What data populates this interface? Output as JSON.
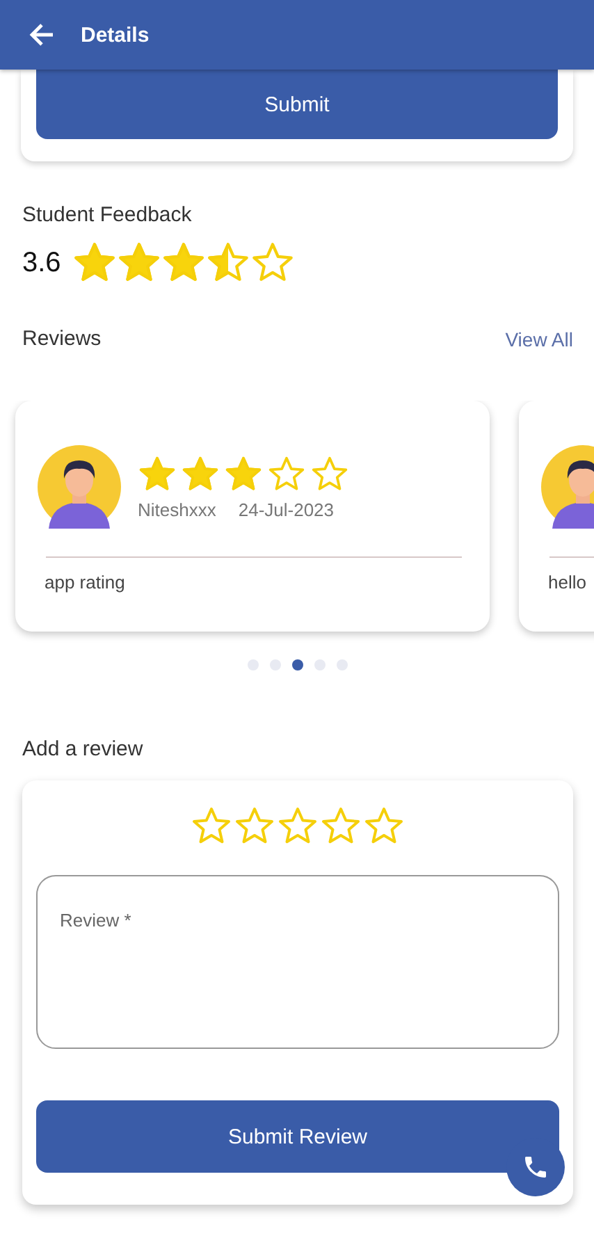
{
  "app_bar": {
    "title": "Details"
  },
  "top_card": {
    "button": "Submit"
  },
  "feedback": {
    "title": "Student Feedback",
    "score": "3.6",
    "stars": 3.5
  },
  "reviews": {
    "title": "Reviews",
    "view_all": "View All",
    "cards": [
      {
        "stars": 3,
        "name": "Niteshxxx",
        "date": "24-Jul-2023",
        "comment": "app rating"
      },
      {
        "comment": "hello"
      }
    ],
    "pager": [
      {
        "selected": false
      },
      {
        "selected": false
      },
      {
        "selected": true
      },
      {
        "selected": false
      },
      {
        "selected": false
      }
    ]
  },
  "add_review": {
    "title": "Add a review",
    "stars": 0,
    "field": {
      "placeholder": "Review *"
    },
    "button": "Submit Review"
  }
}
